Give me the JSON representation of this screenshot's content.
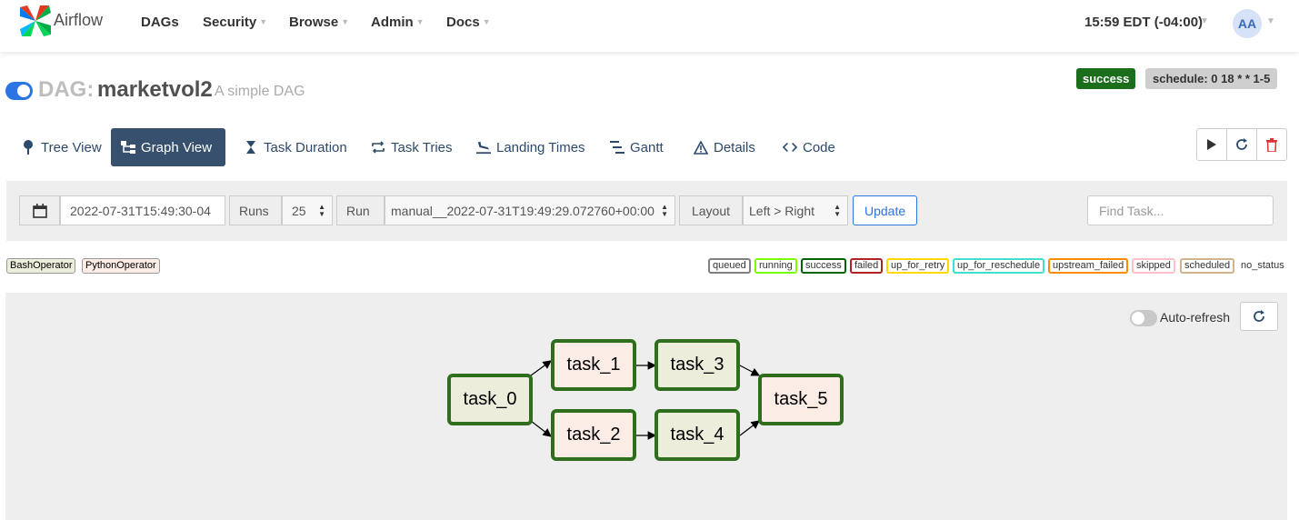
{
  "navbar": {
    "brand": "Airflow",
    "menu": [
      "DAGs",
      "Security",
      "Browse",
      "Admin",
      "Docs"
    ],
    "time": "15:59 EDT (-04:00)",
    "user_initials": "AA"
  },
  "dag": {
    "label": "DAG:",
    "id": "marketvol2",
    "description": "A simple DAG",
    "status": "success",
    "schedule": "schedule: 0 18 * * 1-5",
    "paused_toggle_on": true
  },
  "tabs": [
    {
      "label": "Tree View",
      "icon": "pin-icon"
    },
    {
      "label": "Graph View",
      "icon": "graph-icon",
      "active": true
    },
    {
      "label": "Task Duration",
      "icon": "hourglass-icon"
    },
    {
      "label": "Task Tries",
      "icon": "retry-icon"
    },
    {
      "label": "Landing Times",
      "icon": "plane-landing-icon"
    },
    {
      "label": "Gantt",
      "icon": "gantt-icon"
    },
    {
      "label": "Details",
      "icon": "warning-triangle-icon"
    },
    {
      "label": "Code",
      "icon": "code-icon"
    }
  ],
  "actions": [
    "play-icon",
    "refresh-icon",
    "trash-icon"
  ],
  "controls": {
    "base_date": "2022-07-31T15:49:30-04",
    "runs_label": "Runs",
    "runs_value": "25",
    "run_label": "Run",
    "run_value": "manual__2022-07-31T19:49:29.072760+00:00",
    "layout_label": "Layout",
    "layout_value": "Left > Right",
    "update_label": "Update",
    "find_placeholder": "Find Task..."
  },
  "operators": [
    {
      "label": "BashOperator",
      "color": "#ededdc"
    },
    {
      "label": "PythonOperator",
      "color": "#fbece6"
    }
  ],
  "states": [
    {
      "label": "queued",
      "color": "#808080"
    },
    {
      "label": "running",
      "color": "#7cfc00"
    },
    {
      "label": "success",
      "color": "#006400"
    },
    {
      "label": "failed",
      "color": "#b22222"
    },
    {
      "label": "up_for_retry",
      "color": "#ffd700"
    },
    {
      "label": "up_for_reschedule",
      "color": "#40e0d0"
    },
    {
      "label": "upstream_failed",
      "color": "#ff8c00"
    },
    {
      "label": "skipped",
      "color": "#ffc0cb"
    },
    {
      "label": "scheduled",
      "color": "#d2b48c"
    },
    {
      "label": "no_status",
      "color": ""
    }
  ],
  "graph": {
    "auto_refresh_label": "Auto-refresh",
    "nodes": [
      {
        "id": "task_0",
        "type": "bash"
      },
      {
        "id": "task_1",
        "type": "py"
      },
      {
        "id": "task_2",
        "type": "py"
      },
      {
        "id": "task_3",
        "type": "bash"
      },
      {
        "id": "task_4",
        "type": "bash"
      },
      {
        "id": "task_5",
        "type": "py"
      }
    ],
    "edges": [
      [
        "task_0",
        "task_1"
      ],
      [
        "task_0",
        "task_2"
      ],
      [
        "task_1",
        "task_3"
      ],
      [
        "task_2",
        "task_4"
      ],
      [
        "task_3",
        "task_5"
      ],
      [
        "task_4",
        "task_5"
      ]
    ]
  }
}
